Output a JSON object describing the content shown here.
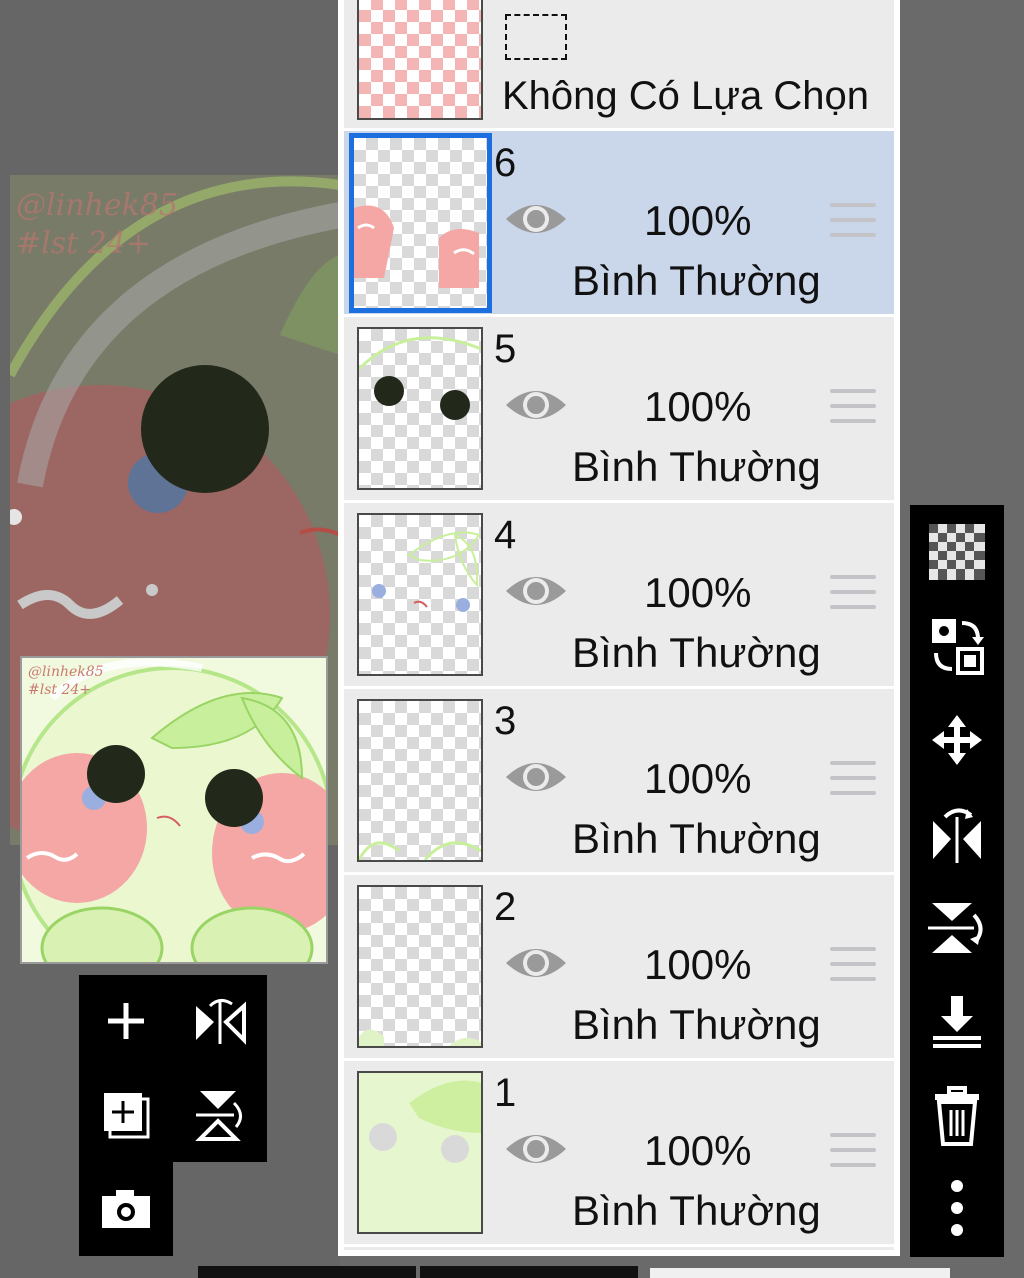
{
  "selection_row": {
    "label": "Không Có Lựa Chọn"
  },
  "canvas": {
    "watermark_line1": "@linhek85",
    "watermark_line2": "#lst 24+"
  },
  "layers": [
    {
      "number": "6",
      "opacity": "100%",
      "blend": "Bình Thường",
      "active": true
    },
    {
      "number": "5",
      "opacity": "100%",
      "blend": "Bình Thường",
      "active": false
    },
    {
      "number": "4",
      "opacity": "100%",
      "blend": "Bình Thường",
      "active": false
    },
    {
      "number": "3",
      "opacity": "100%",
      "blend": "Bình Thường",
      "active": false
    },
    {
      "number": "2",
      "opacity": "100%",
      "blend": "Bình Thường",
      "active": false
    },
    {
      "number": "1",
      "opacity": "100%",
      "blend": "Bình Thường",
      "active": false
    }
  ],
  "left_tools": [
    "plus-icon",
    "flip-horizontal-icon",
    "add-layer-icon",
    "flip-vertical-icon",
    "camera-icon"
  ],
  "right_tools": [
    "checker-icon",
    "transfer-icon",
    "move-icon",
    "flip-horizontal-icon",
    "flip-vertical-icon",
    "merge-down-icon",
    "trash-icon",
    "more-icon"
  ],
  "colors": {
    "active_layer_bg": "#cad6ea",
    "active_border": "#1d6fe0",
    "panel_bg": "#ebebeb",
    "art_pink": "#f4a7a4",
    "art_green": "#c8ef9b",
    "art_dark": "#22291b"
  }
}
